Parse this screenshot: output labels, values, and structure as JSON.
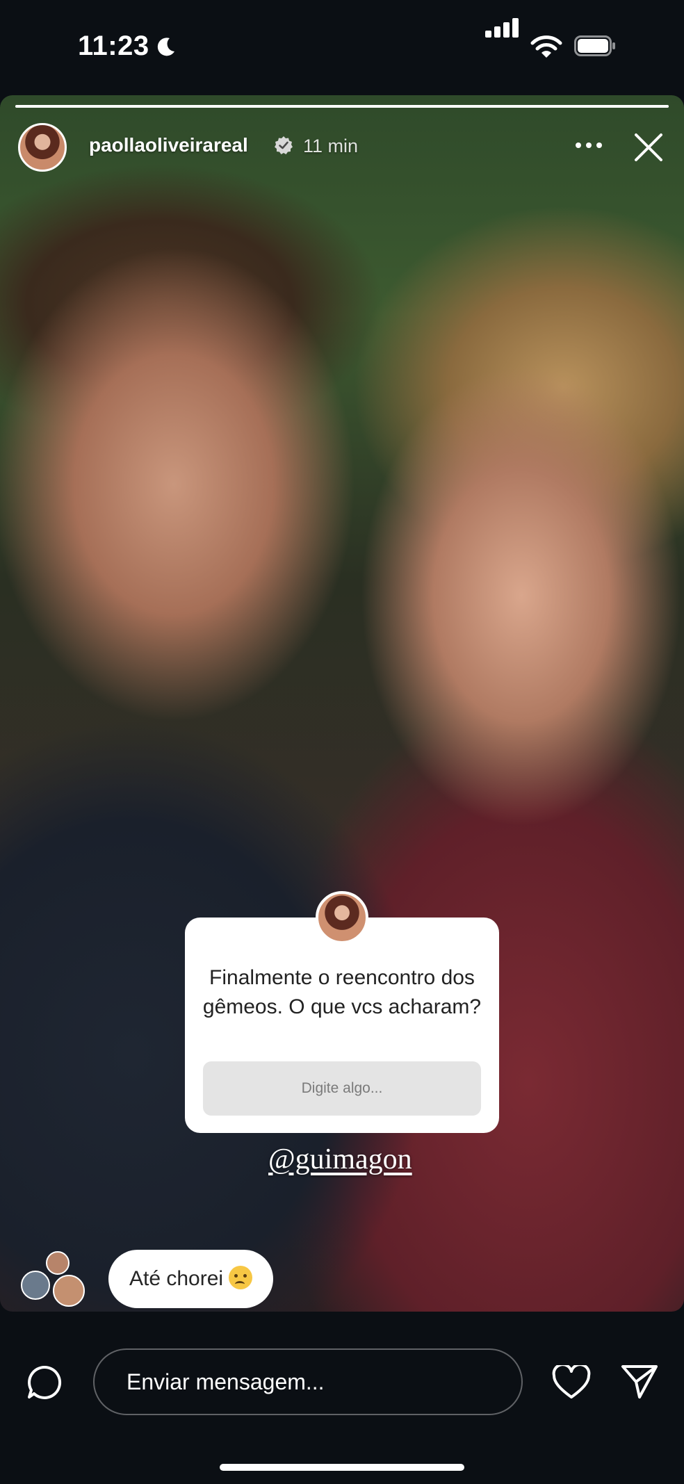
{
  "status_bar": {
    "time": "11:23",
    "icons": [
      "moon-icon",
      "cellular-signal-icon",
      "wifi-icon",
      "battery-icon"
    ]
  },
  "story": {
    "username": "paollaoliveirareal",
    "time_ago": "11 min",
    "verified": true,
    "progress": 1.0,
    "question_sticker": {
      "text": "Finalmente o reencontro dos gêmeos. O que vcs acharam?",
      "placeholder": "Digite algo..."
    },
    "mention": "@guimagon",
    "reaction_reply": "Até chorei"
  },
  "bottom_bar": {
    "message_placeholder": "Enviar mensagem...",
    "icons": [
      "chat-bubble-icon",
      "heart-icon",
      "send-icon"
    ]
  },
  "colors": {
    "background": "#0b0f14",
    "sticker_bg": "#ffffff",
    "input_bg": "#e4e4e4"
  }
}
